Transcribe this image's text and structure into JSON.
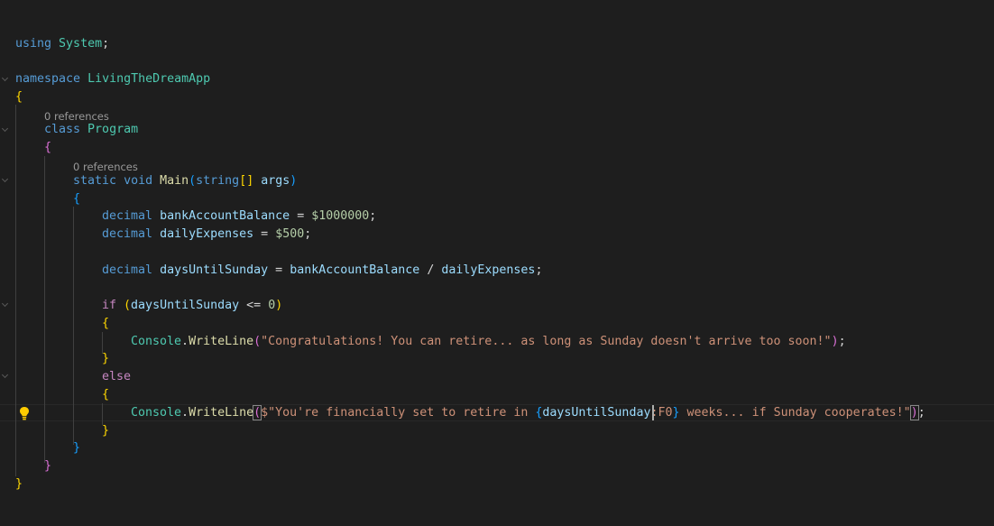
{
  "editor": {
    "codelens": {
      "program_refs": "0 references",
      "main_refs": "0 references"
    },
    "code": {
      "using_kw": "using",
      "using_ns": "System",
      "namespace_kw": "namespace",
      "namespace_name": "LivingTheDreamApp",
      "class_kw": "class",
      "class_name": "Program",
      "static_kw": "static",
      "void_kw": "void",
      "main_name": "Main",
      "string_kw": "string",
      "args_name": "args",
      "decimal_kw": "decimal",
      "var_balance": "bankAccountBalance",
      "balance_value": "$1000000",
      "var_expenses": "dailyExpenses",
      "expenses_value": "$500",
      "var_days": "daysUntilSunday",
      "if_kw": "if",
      "zero_value": "0",
      "else_kw": "else",
      "console_name": "Console",
      "writeline_name": "WriteLine",
      "message_congrats": "\"Congratulations! You can retire... as long as Sunday doesn't arrive too soon!\"",
      "interp_prefix": "$\"You're financially set to retire in ",
      "interp_var": "daysUntilSunday",
      "interp_format": ":F0",
      "interp_suffix": " weeks... if Sunday cooperates!\""
    }
  },
  "colors": {
    "background": "#1e1e1e",
    "keyword": "#569cd6",
    "type": "#4ec9b0",
    "identifier": "#9cdcfe",
    "function": "#dcdcaa",
    "string": "#ce9178",
    "number": "#b5cea8",
    "control": "#c586c0"
  },
  "icons": {
    "lightbulb": "lightbulb-icon",
    "fold": "chevron-down-icon"
  }
}
